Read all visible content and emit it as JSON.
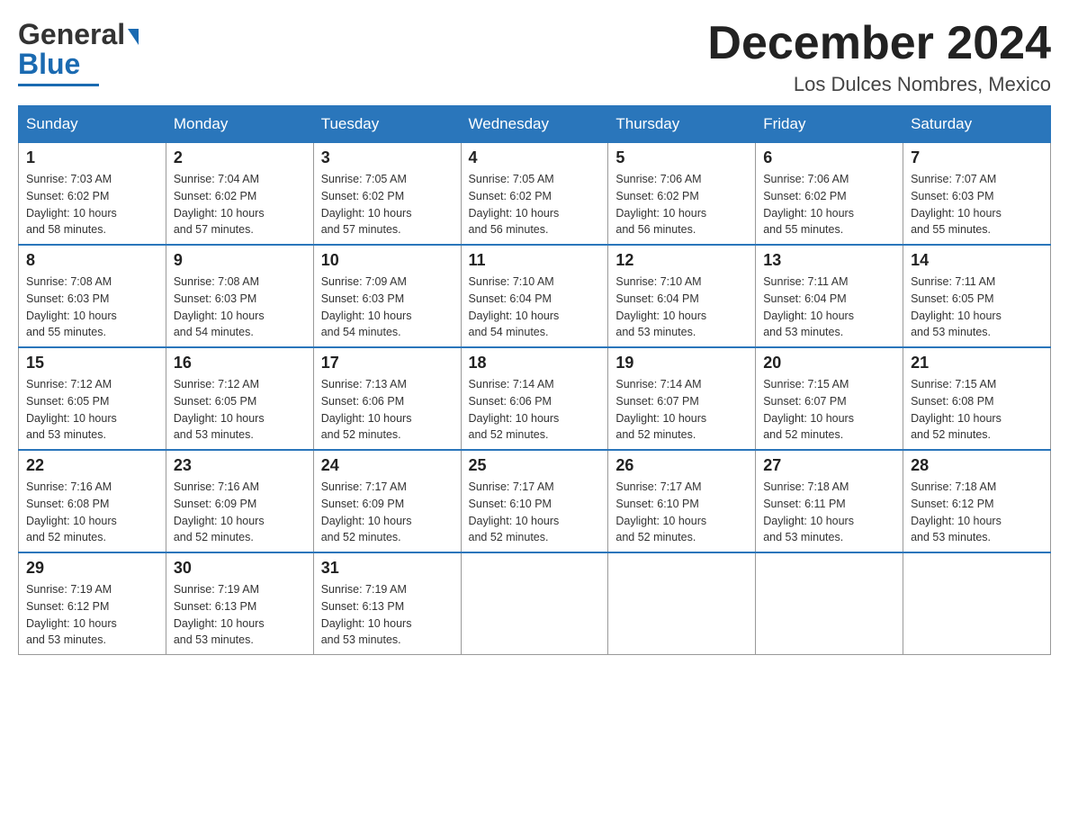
{
  "header": {
    "logo_general": "General",
    "logo_blue": "Blue",
    "month_title": "December 2024",
    "location": "Los Dulces Nombres, Mexico"
  },
  "days_of_week": [
    "Sunday",
    "Monday",
    "Tuesday",
    "Wednesday",
    "Thursday",
    "Friday",
    "Saturday"
  ],
  "weeks": [
    [
      {
        "day": "1",
        "sunrise": "7:03 AM",
        "sunset": "6:02 PM",
        "daylight": "10 hours and 58 minutes."
      },
      {
        "day": "2",
        "sunrise": "7:04 AM",
        "sunset": "6:02 PM",
        "daylight": "10 hours and 57 minutes."
      },
      {
        "day": "3",
        "sunrise": "7:05 AM",
        "sunset": "6:02 PM",
        "daylight": "10 hours and 57 minutes."
      },
      {
        "day": "4",
        "sunrise": "7:05 AM",
        "sunset": "6:02 PM",
        "daylight": "10 hours and 56 minutes."
      },
      {
        "day": "5",
        "sunrise": "7:06 AM",
        "sunset": "6:02 PM",
        "daylight": "10 hours and 56 minutes."
      },
      {
        "day": "6",
        "sunrise": "7:06 AM",
        "sunset": "6:02 PM",
        "daylight": "10 hours and 55 minutes."
      },
      {
        "day": "7",
        "sunrise": "7:07 AM",
        "sunset": "6:03 PM",
        "daylight": "10 hours and 55 minutes."
      }
    ],
    [
      {
        "day": "8",
        "sunrise": "7:08 AM",
        "sunset": "6:03 PM",
        "daylight": "10 hours and 55 minutes."
      },
      {
        "day": "9",
        "sunrise": "7:08 AM",
        "sunset": "6:03 PM",
        "daylight": "10 hours and 54 minutes."
      },
      {
        "day": "10",
        "sunrise": "7:09 AM",
        "sunset": "6:03 PM",
        "daylight": "10 hours and 54 minutes."
      },
      {
        "day": "11",
        "sunrise": "7:10 AM",
        "sunset": "6:04 PM",
        "daylight": "10 hours and 54 minutes."
      },
      {
        "day": "12",
        "sunrise": "7:10 AM",
        "sunset": "6:04 PM",
        "daylight": "10 hours and 53 minutes."
      },
      {
        "day": "13",
        "sunrise": "7:11 AM",
        "sunset": "6:04 PM",
        "daylight": "10 hours and 53 minutes."
      },
      {
        "day": "14",
        "sunrise": "7:11 AM",
        "sunset": "6:05 PM",
        "daylight": "10 hours and 53 minutes."
      }
    ],
    [
      {
        "day": "15",
        "sunrise": "7:12 AM",
        "sunset": "6:05 PM",
        "daylight": "10 hours and 53 minutes."
      },
      {
        "day": "16",
        "sunrise": "7:12 AM",
        "sunset": "6:05 PM",
        "daylight": "10 hours and 53 minutes."
      },
      {
        "day": "17",
        "sunrise": "7:13 AM",
        "sunset": "6:06 PM",
        "daylight": "10 hours and 52 minutes."
      },
      {
        "day": "18",
        "sunrise": "7:14 AM",
        "sunset": "6:06 PM",
        "daylight": "10 hours and 52 minutes."
      },
      {
        "day": "19",
        "sunrise": "7:14 AM",
        "sunset": "6:07 PM",
        "daylight": "10 hours and 52 minutes."
      },
      {
        "day": "20",
        "sunrise": "7:15 AM",
        "sunset": "6:07 PM",
        "daylight": "10 hours and 52 minutes."
      },
      {
        "day": "21",
        "sunrise": "7:15 AM",
        "sunset": "6:08 PM",
        "daylight": "10 hours and 52 minutes."
      }
    ],
    [
      {
        "day": "22",
        "sunrise": "7:16 AM",
        "sunset": "6:08 PM",
        "daylight": "10 hours and 52 minutes."
      },
      {
        "day": "23",
        "sunrise": "7:16 AM",
        "sunset": "6:09 PM",
        "daylight": "10 hours and 52 minutes."
      },
      {
        "day": "24",
        "sunrise": "7:17 AM",
        "sunset": "6:09 PM",
        "daylight": "10 hours and 52 minutes."
      },
      {
        "day": "25",
        "sunrise": "7:17 AM",
        "sunset": "6:10 PM",
        "daylight": "10 hours and 52 minutes."
      },
      {
        "day": "26",
        "sunrise": "7:17 AM",
        "sunset": "6:10 PM",
        "daylight": "10 hours and 52 minutes."
      },
      {
        "day": "27",
        "sunrise": "7:18 AM",
        "sunset": "6:11 PM",
        "daylight": "10 hours and 53 minutes."
      },
      {
        "day": "28",
        "sunrise": "7:18 AM",
        "sunset": "6:12 PM",
        "daylight": "10 hours and 53 minutes."
      }
    ],
    [
      {
        "day": "29",
        "sunrise": "7:19 AM",
        "sunset": "6:12 PM",
        "daylight": "10 hours and 53 minutes."
      },
      {
        "day": "30",
        "sunrise": "7:19 AM",
        "sunset": "6:13 PM",
        "daylight": "10 hours and 53 minutes."
      },
      {
        "day": "31",
        "sunrise": "7:19 AM",
        "sunset": "6:13 PM",
        "daylight": "10 hours and 53 minutes."
      },
      null,
      null,
      null,
      null
    ]
  ],
  "labels": {
    "sunrise": "Sunrise:",
    "sunset": "Sunset:",
    "daylight": "Daylight:"
  }
}
